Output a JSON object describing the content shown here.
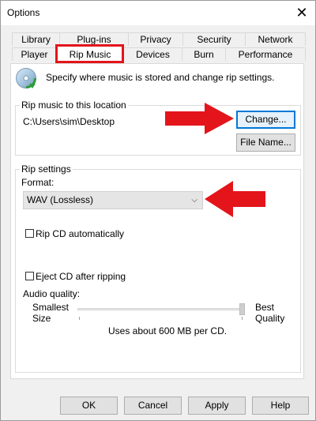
{
  "window": {
    "title": "Options"
  },
  "tabs": {
    "row_back": [
      "Library",
      "Plug-ins",
      "Privacy",
      "Security",
      "Network"
    ],
    "row_front": [
      "Player",
      "Rip Music",
      "Devices",
      "Burn",
      "Performance"
    ],
    "active": "Rip Music"
  },
  "intro": {
    "text": "Specify where music is stored and change rip settings."
  },
  "location": {
    "group_label": "Rip music to this location",
    "path": "C:\\Users\\sim\\Desktop",
    "change_label": "Change...",
    "filename_label": "File Name..."
  },
  "rip_settings": {
    "group_label": "Rip settings",
    "format_label": "Format:",
    "format_value": "WAV (Lossless)",
    "rip_cd_auto_label": "Rip CD automatically",
    "rip_cd_auto_checked": false,
    "eject_label": "Eject CD after ripping",
    "eject_checked": false,
    "audio_quality_label": "Audio quality:",
    "quality_min_label_1": "Smallest",
    "quality_min_label_2": "Size",
    "quality_max_label_1": "Best",
    "quality_max_label_2": "Quality",
    "quality_level": 1.0,
    "usage_text": "Uses about 600 MB per CD."
  },
  "buttons": {
    "ok": "OK",
    "cancel": "Cancel",
    "apply": "Apply",
    "help": "Help"
  },
  "colors": {
    "annotation_red": "#e4141b",
    "focus_blue": "#0078d7"
  },
  "icons": {
    "close": "close-icon",
    "cd": "cd-icon"
  }
}
